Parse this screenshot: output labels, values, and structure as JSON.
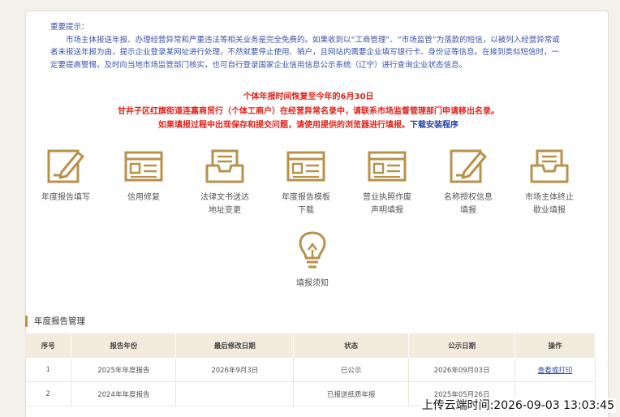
{
  "notice": {
    "title": "重要提示：",
    "body": "市场主体报送年报、办理经营异常和严重违法等相关业务是完全免费的。如果收到以“工商管理”、“市场监管”为落款的短信，以被列入经营异常或者未报送年报为由，提示企业登录某网址进行处理，不然就要停止使用、销户，且网站内需要企业填写银行卡、身份证等信息。在接到类似短信时，一定要提高警惕，及时向当地市场监管部门核实，也可自行登录国家企业信用信息公示系统（辽宁）进行查询企业状态信息。"
  },
  "alerts": {
    "line1": "个体年报时间恢复至今年的6月30日",
    "line2": "甘井子区红旗街道连嘉商贸行（个体工商户）在经营异常名录中，请联系市场监督管理部门申请移出名录。",
    "line3": "如果填报过程中出现保存和提交问题，请使用提供的浏览器进行填报。",
    "download_link": "下载安装程序"
  },
  "tiles": [
    {
      "label": "年度报告填写",
      "icon": "form-pen-icon"
    },
    {
      "label": "信用修复",
      "icon": "window-form-icon"
    },
    {
      "label": "法律文书送达\n地址变更",
      "icon": "inbox-tray-icon"
    },
    {
      "label": "年度报告模板\n下载",
      "icon": "window-form-icon"
    },
    {
      "label": "营业执照作废\n声明填报",
      "icon": "window-form-icon"
    },
    {
      "label": "名称授权信息\n填报",
      "icon": "form-pen-icon"
    },
    {
      "label": "市场主体终止\n歇业填报",
      "icon": "inbox-tray-icon"
    },
    {
      "label": "填报须知",
      "icon": "lightbulb-icon"
    }
  ],
  "section_title": "年度报告管理",
  "table": {
    "headers": [
      "序号",
      "报告年份",
      "最后修改日期",
      "状态",
      "公示日期",
      "操作"
    ],
    "rows": [
      [
        "1",
        "2025年年度报告",
        "2026年9月3日",
        "已公示",
        "2026年09月03日",
        "查看或打印"
      ],
      [
        "2",
        "2024年年度报告",
        "",
        "已报送纸质年报",
        "2025年05月26日",
        ""
      ]
    ]
  },
  "timestamp": "上传云端时间:2026-09-03 13:03:45",
  "colors": {
    "accent": "#b8924b",
    "alert_red": "#e0221b",
    "link_blue": "#2a44a8",
    "notice_blue": "#3a52a8"
  }
}
